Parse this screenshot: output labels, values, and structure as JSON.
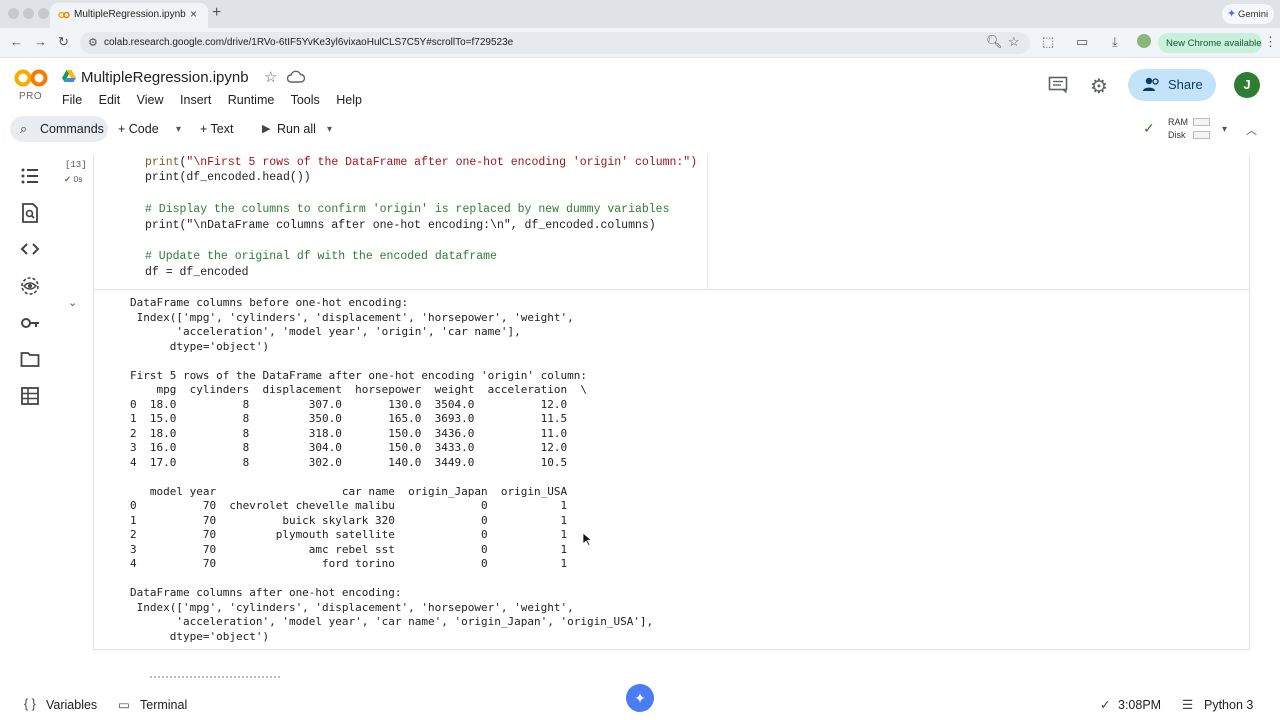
{
  "browser": {
    "tab_title": "MultipleRegression.ipynb - Co",
    "close_glyph": "×",
    "newtab_glyph": "+",
    "gemini_label": "Gemini",
    "url": "colab.research.google.com/drive/1RVo-6tIF5YvKe3yl6vixaoHulCLS7C5Y#scrollTo=f729523e",
    "new_chrome_label": "New Chrome available"
  },
  "header": {
    "logo_text": "CO",
    "plan": "PRO",
    "notebook_title": "MultipleRegression.ipynb",
    "menu": [
      "File",
      "Edit",
      "View",
      "Insert",
      "Runtime",
      "Tools",
      "Help"
    ],
    "share_label": "Share",
    "avatar_letter": "J"
  },
  "toolbar": {
    "commands_label": "Commands",
    "code_label": "+ Code",
    "text_label": "+ Text",
    "run_all_label": "Run all",
    "ram_label": "RAM",
    "disk_label": "Disk"
  },
  "cell": {
    "exec_count": "[13]",
    "exec_time": "0s",
    "code_lines": [
      {
        "kind": "plain",
        "text": "print(\"\\nFirst 5 rows of the DataFrame after one-hot encoding 'origin' column:\")"
      },
      {
        "kind": "plain",
        "text": "print(df_encoded.head())"
      },
      {
        "kind": "blank",
        "text": ""
      },
      {
        "kind": "comment",
        "text": "# Display the columns to confirm 'origin' is replaced by new dummy variables"
      },
      {
        "kind": "plain",
        "text": "print(\"\\nDataFrame columns after one-hot encoding:\\n\", df_encoded.columns)"
      },
      {
        "kind": "blank",
        "text": ""
      },
      {
        "kind": "comment",
        "text": "# Update the original df with the encoded dataframe"
      },
      {
        "kind": "plain",
        "text": "df = df_encoded"
      }
    ],
    "output_lines": [
      "DataFrame columns before one-hot encoding:",
      " Index(['mpg', 'cylinders', 'displacement', 'horsepower', 'weight',",
      "       'acceleration', 'model year', 'origin', 'car name'],",
      "      dtype='object')",
      "",
      "First 5 rows of the DataFrame after one-hot encoding 'origin' column:",
      "    mpg  cylinders  displacement  horsepower  weight  acceleration  \\",
      "0  18.0          8         307.0       130.0  3504.0          12.0",
      "1  15.0          8         350.0       165.0  3693.0          11.5",
      "2  18.0          8         318.0       150.0  3436.0          11.0",
      "3  16.0          8         304.0       150.0  3433.0          12.0",
      "4  17.0          8         302.0       140.0  3449.0          10.5",
      "",
      "   model year                   car name  origin_Japan  origin_USA",
      "0          70  chevrolet chevelle malibu             0           1",
      "1          70          buick skylark 320             0           1",
      "2          70         plymouth satellite             0           1",
      "3          70              amc rebel sst             0           1",
      "4          70                ford torino             0           1",
      "",
      "DataFrame columns after one-hot encoding:",
      " Index(['mpg', 'cylinders', 'displacement', 'horsepower', 'weight',",
      "       'acceleration', 'model year', 'car name', 'origin_Japan', 'origin_USA'],",
      "      dtype='object')"
    ]
  },
  "statusbar": {
    "variables_label": "Variables",
    "terminal_label": "Terminal",
    "time": "3:08PM",
    "runtime": "Python 3"
  }
}
